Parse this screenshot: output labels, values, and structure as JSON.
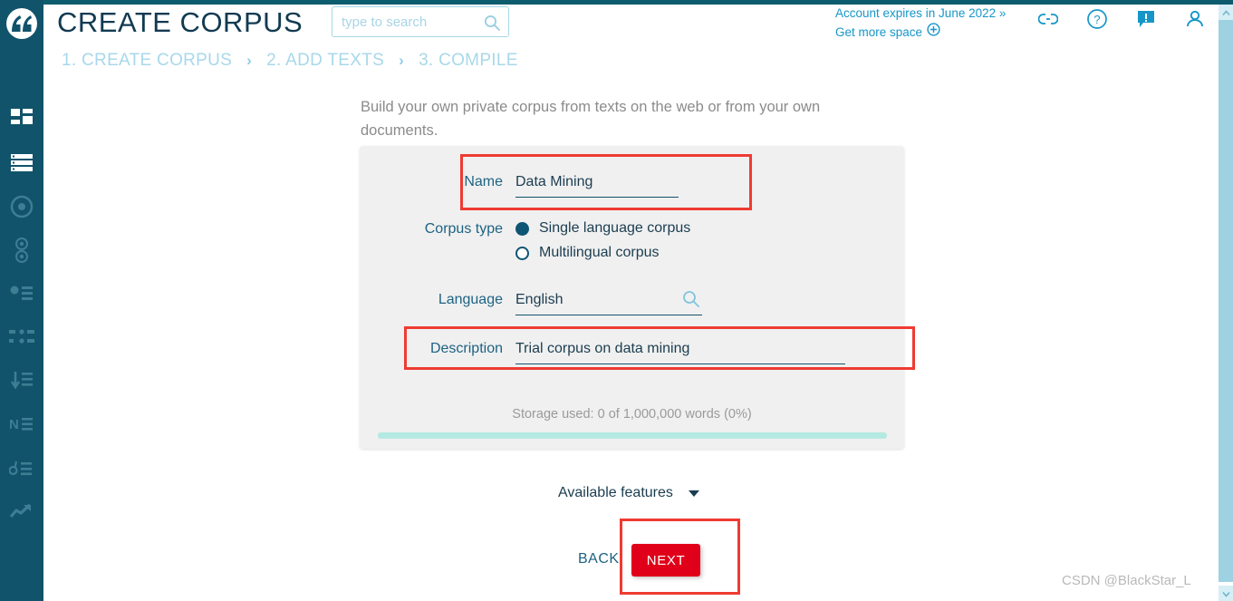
{
  "header": {
    "app_title": "CREATE CORPUS",
    "search_placeholder": "type to search",
    "search_value": "",
    "search_icon": "search-icon",
    "account_expiry": "Account expires in June 2022 »",
    "get_more_space": "Get more space",
    "get_more_space_icon": "plus-circle-icon",
    "icons": [
      {
        "name": "link-icon",
        "label": "Share link"
      },
      {
        "name": "question-circle-icon",
        "label": "Help"
      },
      {
        "name": "feedback-icon",
        "label": "Feedback"
      },
      {
        "name": "user-icon",
        "label": "Account"
      }
    ]
  },
  "breadcrumb": {
    "separator": "›",
    "items": [
      {
        "label": "1. CREATE CORPUS"
      },
      {
        "label": "2. ADD TEXTS"
      },
      {
        "label": "3. COMPILE"
      }
    ]
  },
  "sidebar": {
    "logo_icon": "quote-marks-logo-icon",
    "items": [
      {
        "icon": "dashboard-grid-icon",
        "label": "Dashboard"
      },
      {
        "icon": "corpus-list-icon",
        "label": "Corpora"
      },
      {
        "icon": "word-sketch-target-icon",
        "label": "Word Sketch"
      },
      {
        "icon": "sketch-diff-icon",
        "label": "Sketch Difference"
      },
      {
        "icon": "thesaurus-icon",
        "label": "Thesaurus"
      },
      {
        "icon": "concordance-icon",
        "label": "Concordance"
      },
      {
        "icon": "wordlist-sort-icon",
        "label": "Word List"
      },
      {
        "icon": "n-grams-icon",
        "label": "N-grams"
      },
      {
        "icon": "keywords-icon",
        "label": "Keywords"
      },
      {
        "icon": "trends-arrow-icon",
        "label": "Trends"
      }
    ]
  },
  "main": {
    "intro": "Build your own private corpus from texts on the web or from your own documents.",
    "form": {
      "name": {
        "label": "Name",
        "value": "Data Mining"
      },
      "corpus_type": {
        "label": "Corpus type",
        "options": [
          {
            "label": "Single language corpus",
            "selected": true
          },
          {
            "label": "Multilingual corpus",
            "selected": false
          }
        ]
      },
      "language": {
        "label": "Language",
        "value": "English",
        "icon": "search-icon"
      },
      "description": {
        "label": "Description",
        "value": "Trial corpus on data mining"
      }
    },
    "storage_text": "Storage used: 0 of 1,000,000 words (0%)",
    "storage_percent": 0,
    "available_features": "Available features",
    "available_features_icon": "chevron-down-icon",
    "back_label": "BACK",
    "next_label": "NEXT"
  },
  "annotations": {
    "highlight_color": "#ef3b32",
    "boxes": [
      {
        "target": "name-field"
      },
      {
        "target": "description-field"
      },
      {
        "target": "next-button"
      }
    ]
  },
  "watermark": {
    "text": "CSDN @BlackStar_L"
  },
  "scrollbar": {
    "up_icon": "chevron-up-icon",
    "down_icon": "chevron-down-icon"
  },
  "colors": {
    "sidebar": "#11536b",
    "accent_blue": "#1696c8",
    "panel": "#f0f0f0",
    "next_button": "#e1001a",
    "progress": "#b4e9e2"
  }
}
